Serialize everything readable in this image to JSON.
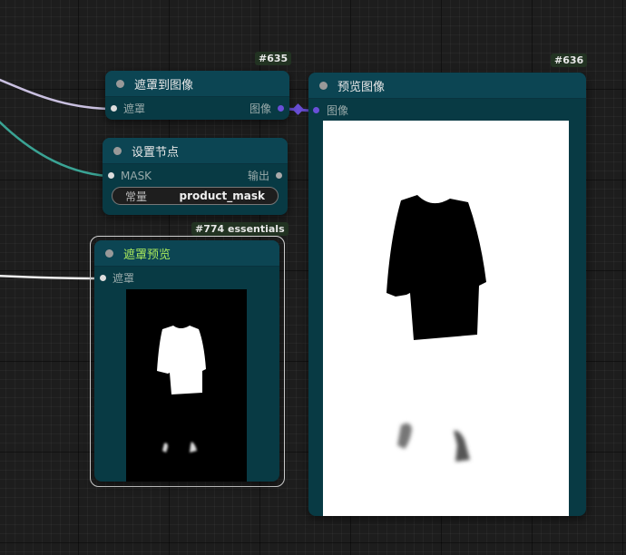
{
  "nodes": {
    "mask_to_image": {
      "id": "#635",
      "title": "遮罩到图像",
      "input": "遮罩",
      "output": "图像"
    },
    "set_node": {
      "title": "设置节点",
      "input": "MASK",
      "output": "输出",
      "widget_label": "常量",
      "widget_value": "product_mask"
    },
    "mask_preview": {
      "id": "#774 essentials",
      "title": "遮罩预览",
      "input": "遮罩"
    },
    "preview_image": {
      "id": "#636",
      "title": "预览图像",
      "input": "图像"
    }
  },
  "colors": {
    "canvas": "#1d1d1d",
    "node_body": "#083a44",
    "node_header": "#0c4553",
    "title_highlight": "#a8e85c",
    "image_link": "#6a4fd8",
    "mask_link_lavender": "#c9c0e0",
    "mask_link_teal": "#3aa394",
    "badge_bg": "#223322"
  },
  "icons": {
    "node_status": "circle-dot-icon",
    "input_slot": "slot-dot-icon",
    "output_slot": "slot-dot-icon"
  }
}
